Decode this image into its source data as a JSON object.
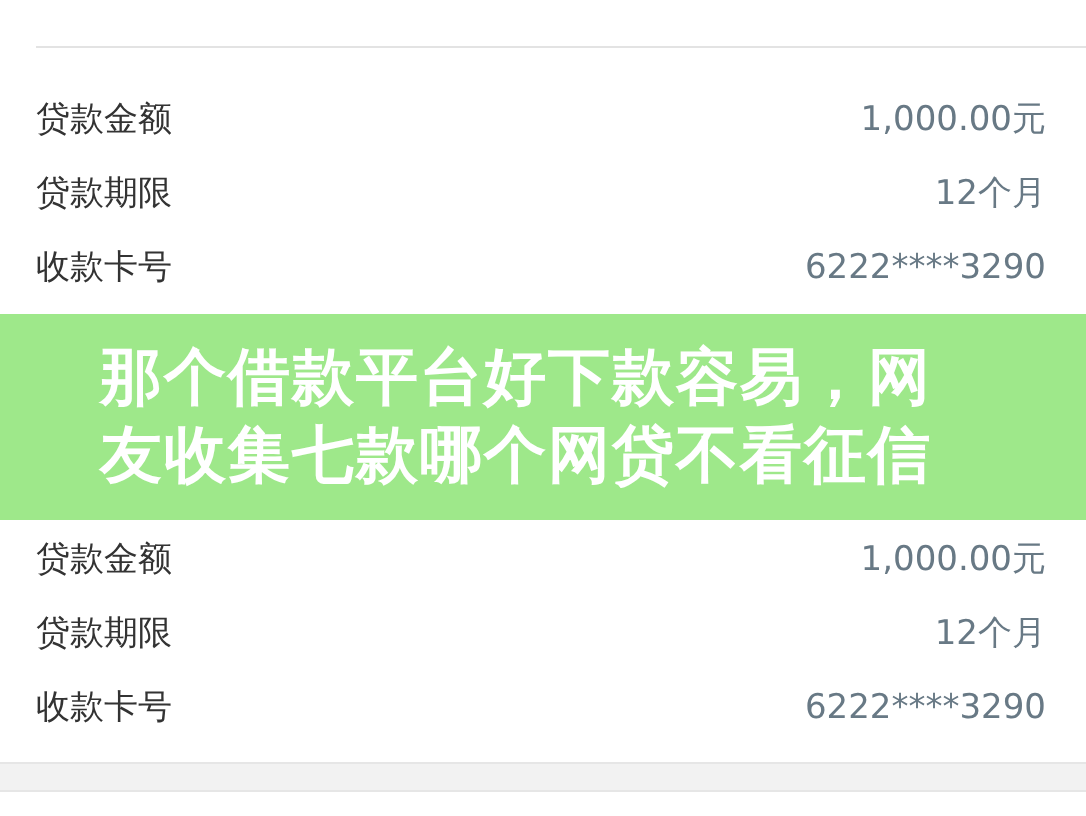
{
  "cards": [
    {
      "rows": [
        {
          "label": "贷款金额",
          "value": "1,000.00元"
        },
        {
          "label": "贷款期限",
          "value": "12个月"
        },
        {
          "label": "收款卡号",
          "value": "6222****3290"
        }
      ]
    },
    {
      "rows": [
        {
          "label": "贷款金额",
          "value": "1,000.00元"
        },
        {
          "label": "贷款期限",
          "value": "12个月"
        },
        {
          "label": "收款卡号",
          "value": "6222****3290"
        }
      ]
    }
  ],
  "banner": {
    "lines": [
      "那个借款平台好下款容易，网",
      "友收集七款哪个网贷不看征信"
    ]
  }
}
